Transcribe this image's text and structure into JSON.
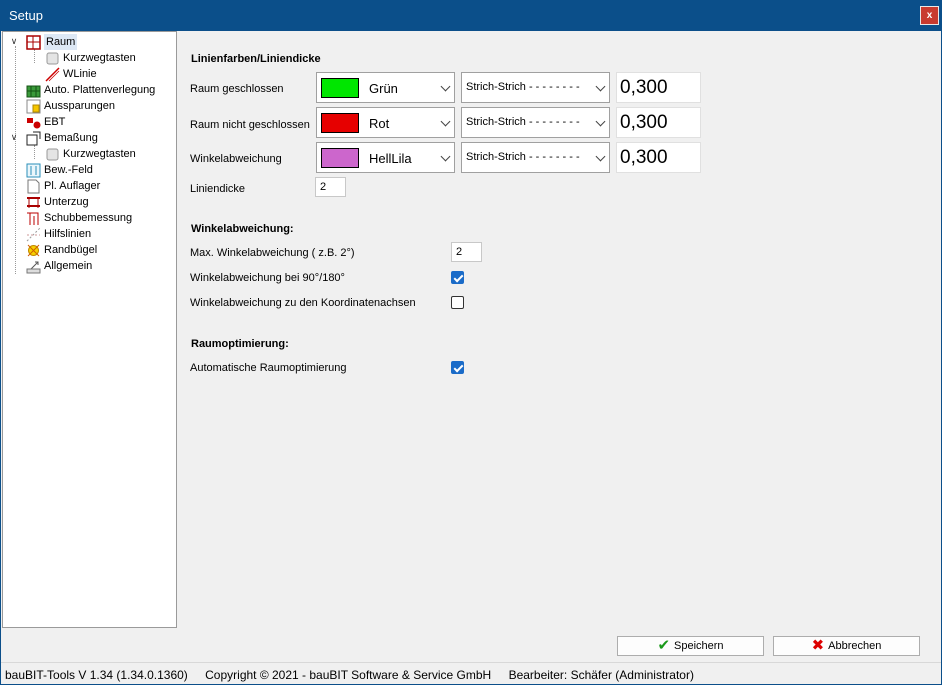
{
  "window": {
    "title": "Setup",
    "close_label": "x"
  },
  "tree": {
    "items": [
      {
        "label": "Raum",
        "icon": "room-icon",
        "selected": true
      },
      {
        "label": "Kurzwegtasten",
        "icon": "shortcut-keys-icon"
      },
      {
        "label": "WLinie",
        "icon": "wall-line-icon"
      },
      {
        "label": "Auto. Plattenverlegung",
        "icon": "plate-layout-icon"
      },
      {
        "label": "Aussparungen",
        "icon": "cutout-icon"
      },
      {
        "label": "EBT",
        "icon": "ebt-icon"
      },
      {
        "label": "Bemaßung",
        "icon": "dimension-icon"
      },
      {
        "label": "Kurzwegtasten",
        "icon": "shortcut-keys-icon"
      },
      {
        "label": "Bew.-Feld",
        "icon": "reinforcement-field-icon"
      },
      {
        "label": "Pl. Auflager",
        "icon": "plate-support-icon"
      },
      {
        "label": "Unterzug",
        "icon": "beam-icon"
      },
      {
        "label": "Schubbemessung",
        "icon": "shear-design-icon"
      },
      {
        "label": "Hilfslinien",
        "icon": "guide-lines-icon"
      },
      {
        "label": "Randbügel",
        "icon": "edge-stirrup-icon"
      },
      {
        "label": "Allgemein",
        "icon": "general-settings-icon"
      }
    ]
  },
  "linecolors": {
    "title": "Linienfarben/Liniendicke",
    "rows": [
      {
        "label": "Raum geschlossen",
        "color_name": "Grün",
        "color": "#00e600",
        "linestyle": "Strich-Strich - - - - - - - -",
        "value": "0,300"
      },
      {
        "label": "Raum nicht geschlossen",
        "color_name": "Rot",
        "color": "#e60000",
        "linestyle": "Strich-Strich - - - - - - - -",
        "value": "0,300"
      },
      {
        "label": "Winkelabweichung",
        "color_name": "HellLila",
        "color": "#cc66cc",
        "linestyle": "Strich-Strich - - - - - - - -",
        "value": "0,300"
      }
    ],
    "linewidth_label": "Liniendicke",
    "linewidth_value": "2"
  },
  "angle": {
    "title": "Winkelabweichung:",
    "max_label": "Max. Winkelabweichung ( z.B. 2°)",
    "max_value": "2",
    "check_90_label": "Winkelabweichung bei 90°/180°",
    "check_90": true,
    "check_axes_label": "Winkelabweichung zu den Koordinatenachsen",
    "check_axes": false
  },
  "optimization": {
    "title": "Raumoptimierung:",
    "auto_label": "Automatische Raumoptimierung",
    "auto": true
  },
  "buttons": {
    "save": "Speichern",
    "cancel": "Abbrechen"
  },
  "status": {
    "version": "bauBIT-Tools V 1.34 (1.34.0.1360)",
    "copyright": "Copyright © 2021 - bauBIT Software & Service GmbH",
    "editor": "Bearbeiter: Schäfer (Administrator)"
  }
}
